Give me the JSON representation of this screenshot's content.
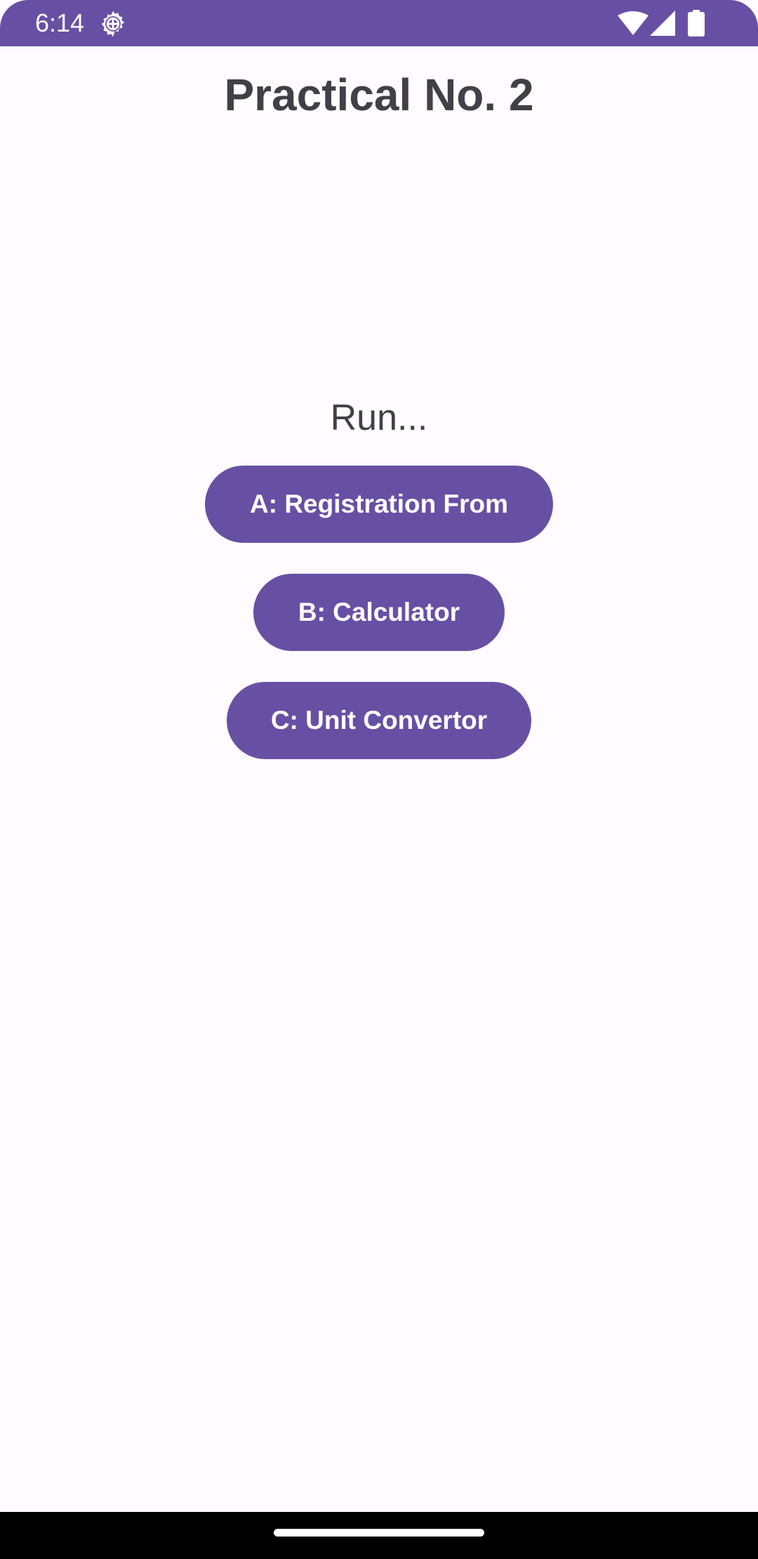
{
  "status_bar": {
    "time": "6:14",
    "icons": [
      "gear-icon",
      "wifi-icon",
      "signal-icon",
      "battery-icon"
    ],
    "background_color": "#6750a4"
  },
  "main": {
    "title": "Practical No. 2",
    "run_label": "Run...",
    "buttons": [
      {
        "label": "A: Registration From"
      },
      {
        "label": "B: Calculator"
      },
      {
        "label": "C: Unit Convertor"
      }
    ]
  },
  "colors": {
    "primary": "#6750a4",
    "on_primary": "#ffffff",
    "background": "#fffbfe",
    "text": "#424047",
    "nav_bar": "#000000"
  }
}
